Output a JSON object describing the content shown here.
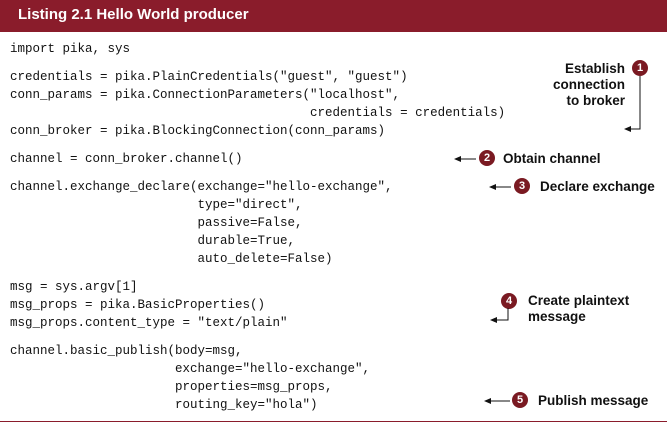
{
  "listing": {
    "title": "Listing 2.1    Hello World producer"
  },
  "code": {
    "import": "import pika, sys",
    "creds": "credentials = pika.PlainCredentials(\"guest\", \"guest\")",
    "conn_params_1": "conn_params = pika.ConnectionParameters(\"localhost\",",
    "conn_params_2": "                                        credentials = credentials)",
    "conn_broker": "conn_broker = pika.BlockingConnection(conn_params)",
    "channel": "channel = conn_broker.channel()",
    "exchange_1": "channel.exchange_declare(exchange=\"hello-exchange\",",
    "exchange_2": "                         type=\"direct\",",
    "exchange_3": "                         passive=False,",
    "exchange_4": "                         durable=True,",
    "exchange_5": "                         auto_delete=False)",
    "msg": "msg = sys.argv[1]",
    "msg_props": "msg_props = pika.BasicProperties()",
    "content_type": "msg_props.content_type = \"text/plain\"",
    "publish_1": "channel.basic_publish(body=msg,",
    "publish_2": "                      exchange=\"hello-exchange\",",
    "publish_3": "                      properties=msg_props,",
    "publish_4": "                      routing_key=\"hola\")"
  },
  "annotations": {
    "a1_line1": "Establish connection",
    "a1_line2": "to broker",
    "a1_num": "1",
    "a2": "Obtain channel",
    "a2_num": "2",
    "a3": "Declare exchange",
    "a3_num": "3",
    "a4_line1": "Create plaintext",
    "a4_line2": "message",
    "a4_num": "4",
    "a5": "Publish message",
    "a5_num": "5"
  },
  "colors": {
    "header_bg": "#8a1c2b",
    "callout_bg": "#7a1a22"
  }
}
